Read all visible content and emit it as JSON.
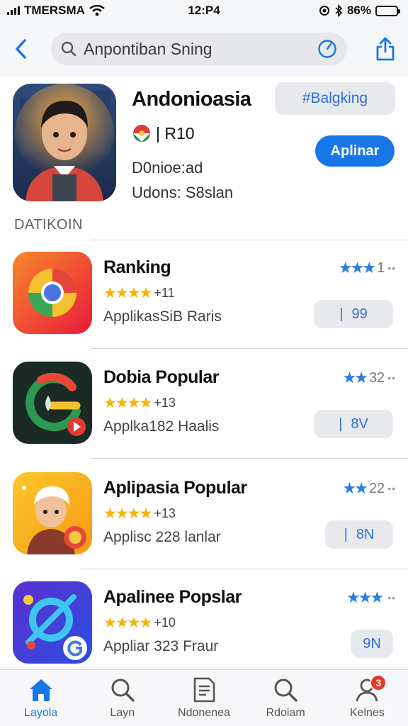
{
  "status_bar": {
    "carrier": "TMERSMA",
    "time": "12:P4",
    "battery": "86%",
    "battery_level": 0.86
  },
  "nav": {
    "search_text": "Anpontiban Sning"
  },
  "header_app": {
    "title": "Andonioasia",
    "rating": "| R10",
    "line1": "D0nioe:ad",
    "line2": "Udons: S8slan",
    "tag": "#Balgking",
    "action": "Aplinar"
  },
  "section_label": "DATIKOIN",
  "list": [
    {
      "title": "Ranking",
      "stars": "★★★★",
      "stars_count": "+11",
      "desc": "ApplikasSiB Raris",
      "rank_stars": "★★★",
      "rank_value": "1",
      "button_label": "99"
    },
    {
      "title": "Dobia Popular",
      "stars": "★★★★",
      "stars_count": "+13",
      "desc": "Applka182 Haalis",
      "rank_stars": "★★",
      "rank_value": "32",
      "button_label": "8V"
    },
    {
      "title": "Aplipasia Popular",
      "stars": "★★★★",
      "stars_count": "+13",
      "desc": "Applisc 228 lanlar",
      "rank_stars": "★★",
      "rank_value": "22",
      "button_label": "8N"
    },
    {
      "title": "Apalinee Popslar",
      "stars": "★★★★",
      "stars_count": "+10",
      "desc": "Appliar 323 Fraur",
      "rank_stars": "★★★",
      "rank_value": "",
      "button_label": "9N"
    }
  ],
  "tabbar": [
    {
      "label": "Layola",
      "icon": "home-icon",
      "active": true
    },
    {
      "label": "Layn",
      "icon": "search-icon",
      "active": false
    },
    {
      "label": "Ndonenea",
      "icon": "document-icon",
      "active": false
    },
    {
      "label": "Rdoiam",
      "icon": "search-icon",
      "active": false
    },
    {
      "label": "Kelnes",
      "icon": "person-icon",
      "active": false,
      "badge": "3"
    }
  ],
  "colors": {
    "accent": "#1877e6",
    "star": "#f4b400",
    "rank_star": "#2a7de1",
    "badge": "#e8362b"
  }
}
